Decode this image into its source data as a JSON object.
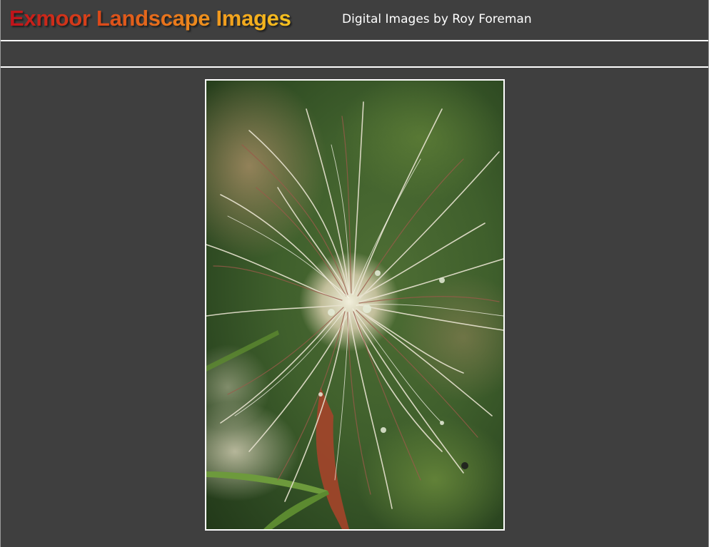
{
  "header": {
    "title": "Exmoor Landscape Images",
    "subtitle": "Digital Images by Roy Foreman"
  },
  "photo": {
    "subject": "pasque-flower-seedhead-image"
  },
  "colors": {
    "background": "#3f3f3f",
    "divider": "#ffffff",
    "title_gradient_start": "#c0121a",
    "title_gradient_end": "#f6c21f"
  }
}
